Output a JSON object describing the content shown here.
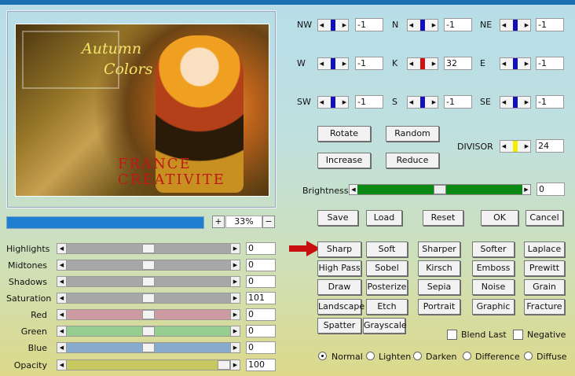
{
  "preview": {
    "watermark_line1": "FRANCE",
    "watermark_line2": "CREATIVITE",
    "title_line1": "Autumn",
    "title_line2": "Colors"
  },
  "zoom": {
    "plus": "+",
    "minus": "−",
    "value": "33%"
  },
  "sliders": [
    {
      "label": "Highlights",
      "value": "0",
      "color": "#a7a7a7",
      "level": 0.5
    },
    {
      "label": "Midtones",
      "value": "0",
      "color": "#a7a7a7",
      "level": 0.5
    },
    {
      "label": "Shadows",
      "value": "0",
      "color": "#a7a7a7",
      "level": 0.5
    },
    {
      "label": "Saturation",
      "value": "101",
      "color": "#a7a7a7",
      "level": 0.5
    },
    {
      "label": "Red",
      "value": "0",
      "color": "#cc9aa0",
      "level": 0.5
    },
    {
      "label": "Green",
      "value": "0",
      "color": "#96cc90",
      "level": 0.5
    },
    {
      "label": "Blue",
      "value": "0",
      "color": "#88aacc",
      "level": 0.5
    },
    {
      "label": "Opacity",
      "value": "100",
      "color": "#c8c860",
      "level": 1.0
    }
  ],
  "directions": [
    {
      "label": "NW",
      "value": "-1",
      "indicator": "#1010c0"
    },
    {
      "label": "N",
      "value": "-1",
      "indicator": "#1010c0"
    },
    {
      "label": "NE",
      "value": "-1",
      "indicator": "#1010c0"
    },
    {
      "label": "W",
      "value": "-1",
      "indicator": "#1010c0"
    },
    {
      "label": "K",
      "value": "32",
      "indicator": "#d01010"
    },
    {
      "label": "E",
      "value": "-1",
      "indicator": "#1010c0"
    },
    {
      "label": "SW",
      "value": "-1",
      "indicator": "#1010c0"
    },
    {
      "label": "S",
      "value": "-1",
      "indicator": "#1010c0"
    },
    {
      "label": "SE",
      "value": "-1",
      "indicator": "#1010c0"
    }
  ],
  "divisor": {
    "label": "DIVISOR",
    "value": "24",
    "indicator": "#f0f000"
  },
  "buttons_top": {
    "rotate": "Rotate",
    "random": "Random",
    "increase": "Increase",
    "reduce": "Reduce"
  },
  "brightness": {
    "label": "Brightness",
    "value": "0",
    "level": 0.5
  },
  "actions": {
    "save": "Save",
    "load": "Load",
    "reset": "Reset",
    "ok": "OK",
    "cancel": "Cancel"
  },
  "presets": [
    "Sharp",
    "Soft",
    "Sharper",
    "Softer",
    "Laplace",
    "High Pass",
    "Sobel",
    "Kirsch",
    "Emboss",
    "Prewitt",
    "Draw",
    "Posterize",
    "Sepia",
    "Noise",
    "Grain",
    "Landscape",
    "Etch",
    "Portrait",
    "Graphic",
    "Fracture",
    "Spatter",
    "Grayscale"
  ],
  "checks": {
    "blend_last": "Blend Last",
    "negative": "Negative"
  },
  "modes": {
    "normal": "Normal",
    "lighten": "Lighten",
    "darken": "Darken",
    "difference": "Difference",
    "diffuse": "Diffuse",
    "selected": "Normal"
  }
}
